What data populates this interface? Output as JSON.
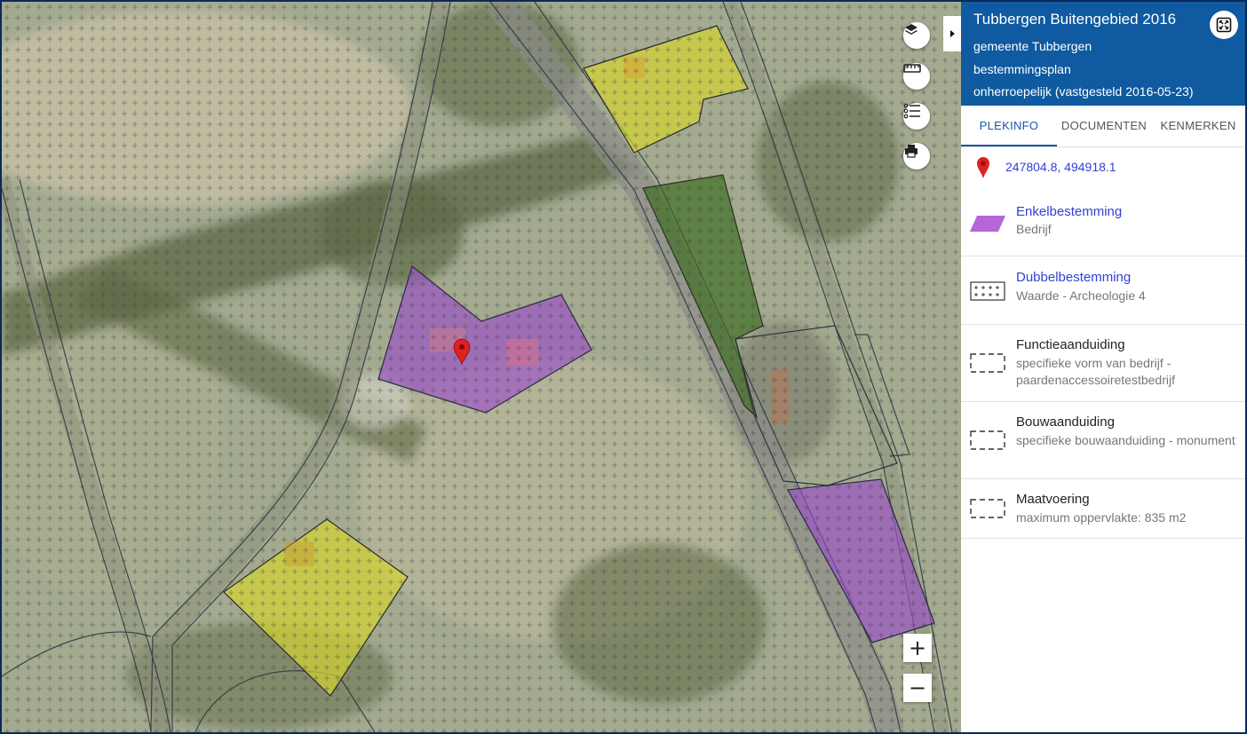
{
  "header": {
    "title": "Tubbergen Buitengebied 2016",
    "line1": "gemeente Tubbergen",
    "line2": "bestemmingsplan",
    "line3": "onherroepelijk (vastgesteld 2016-05-23)"
  },
  "tabs": [
    "PLEKINFO",
    "DOCUMENTEN",
    "KENMERKEN"
  ],
  "active_tab": "PLEKINFO",
  "location": {
    "coordinates": "247804.8, 494918.1"
  },
  "entries": [
    {
      "title": "Enkelbestemming",
      "sub": "Bedrijf",
      "icon": "enkelbestemming-purple-swatch-icon",
      "link": true
    },
    {
      "title": "Dubbelbestemming",
      "sub": "Waarde - Archeologie 4",
      "icon": "archeologie-grid-icon",
      "link": true
    },
    {
      "title": "Functieaanduiding",
      "sub": "specifieke vorm van bedrijf - paardenaccessoiretestbedrijf",
      "icon": "dashed-box-icon",
      "link": false
    },
    {
      "title": "Bouwaanduiding",
      "sub": "specifieke bouwaanduiding - monument",
      "icon": "dashed-box-icon",
      "link": false
    },
    {
      "title": "Maatvoering",
      "sub": "maximum oppervlakte: 835 m2",
      "icon": "dashed-box-icon",
      "link": false
    }
  ],
  "map_controls": {
    "icons": [
      "layers-icon",
      "ruler-icon",
      "legend-list-icon",
      "print-icon"
    ],
    "zoom_in": "+",
    "zoom_out": "−"
  },
  "colors": {
    "header_bg": "#0f5aa0",
    "accent": "#1a56a8",
    "link": "#3340d6",
    "bedrijf": "#9b4fc9",
    "yellow_zone": "#d4d432",
    "green_zone": "#4a7a2a",
    "marker": "#e02020"
  }
}
